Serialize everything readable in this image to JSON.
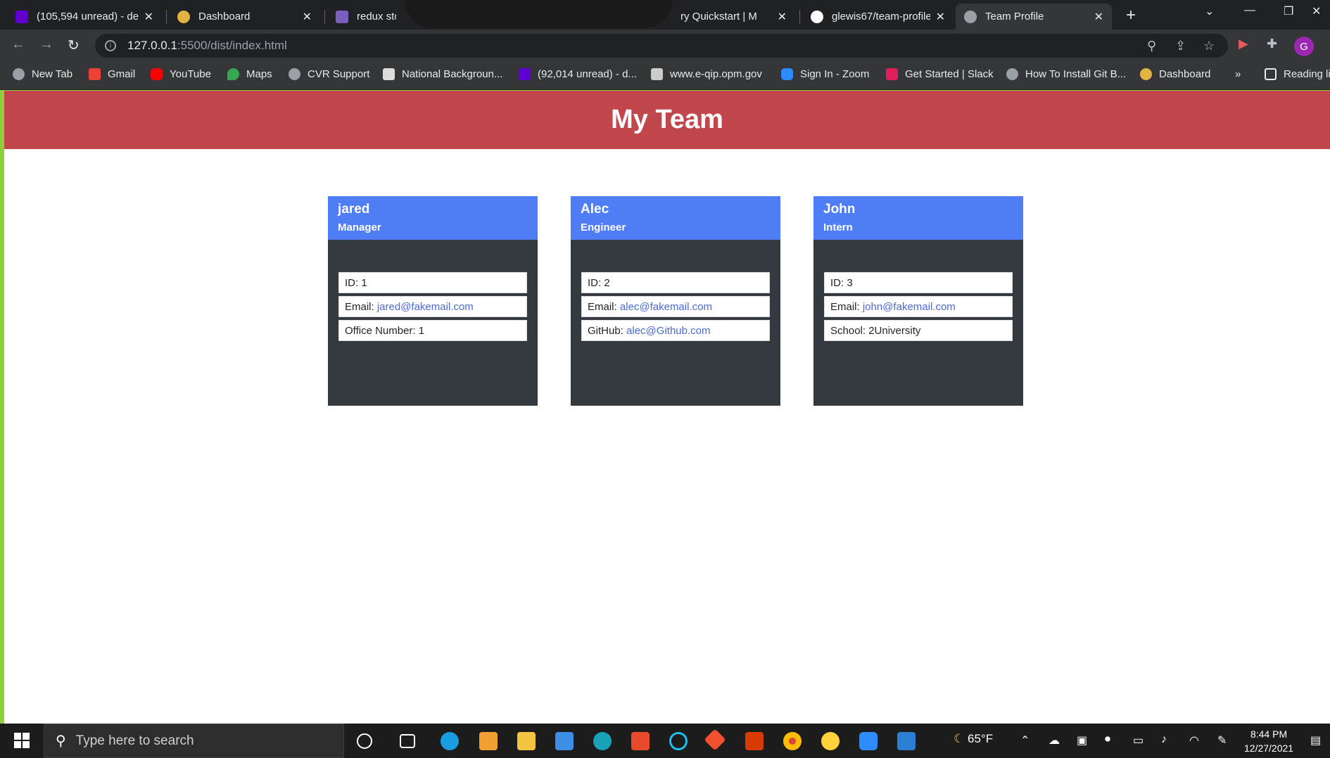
{
  "browser": {
    "tabs": [
      {
        "title": "(105,594 unread) - de",
        "icon": "yahoo-mail-icon",
        "color": "#6001d2"
      },
      {
        "title": "Dashboard",
        "icon": "coin-icon",
        "color": "#e3b341"
      },
      {
        "title": "redux store",
        "icon": "h-icon",
        "color": "#7a5fbf"
      },
      {
        "title": "ry Quickstart | M",
        "icon": "",
        "color": ""
      },
      {
        "title": "glewis67/team-profile",
        "icon": "github-icon",
        "color": "#ffffff"
      },
      {
        "title": "Team Profile",
        "icon": "globe-icon",
        "color": "#9aa0a6"
      }
    ],
    "url_host": "127.0.0.1",
    "url_path": ":5500/dist/index.html",
    "profile_initial": "G",
    "bookmarks": [
      {
        "label": "New Tab",
        "icon": "globe-icon",
        "color": "#9aa0a6"
      },
      {
        "label": "Gmail",
        "icon": "gmail-icon",
        "color": "#ea4335"
      },
      {
        "label": "YouTube",
        "icon": "youtube-icon",
        "color": "#ff0000"
      },
      {
        "label": "Maps",
        "icon": "maps-pin-icon",
        "color": "#34a853"
      },
      {
        "label": "CVR Support",
        "icon": "globe-icon",
        "color": "#9aa0a6"
      },
      {
        "label": "National Backgroun...",
        "icon": "doc-icon",
        "color": "#dddddd"
      },
      {
        "label": "(92,014 unread) - d...",
        "icon": "yahoo-mail-icon",
        "color": "#6001d2"
      },
      {
        "label": "www.e-qip.opm.gov",
        "icon": "eagle-icon",
        "color": "#cccccc"
      },
      {
        "label": "Sign In - Zoom",
        "icon": "zoom-icon",
        "color": "#2d8cff"
      },
      {
        "label": "Get Started | Slack",
        "icon": "slack-icon",
        "color": "#e01e5a"
      },
      {
        "label": "How To Install Git B...",
        "icon": "globe-icon",
        "color": "#9aa0a6"
      },
      {
        "label": "Dashboard",
        "icon": "coin-icon",
        "color": "#e3b341"
      }
    ],
    "bookmarks_overflow": "»",
    "reading_list": "Reading li"
  },
  "page": {
    "title": "My Team",
    "header_color": "#c2474d",
    "card_header_color": "#4f7df5",
    "cards": [
      {
        "name": "jared",
        "role": "Manager",
        "id_label": "ID: 1",
        "email_prefix": "Email: ",
        "email": "jared@fakemail.com",
        "extra_prefix": "Office Number: 1",
        "extra_link": ""
      },
      {
        "name": "Alec",
        "role": "Engineer",
        "id_label": "ID: 2",
        "email_prefix": "Email: ",
        "email": "alec@fakemail.com",
        "extra_prefix": "GitHub: ",
        "extra_link": "alec@Github.com"
      },
      {
        "name": "John",
        "role": "Intern",
        "id_label": "ID: 3",
        "email_prefix": "Email: ",
        "email": "john@fakemail.com",
        "extra_prefix": "School: 2University",
        "extra_link": ""
      }
    ]
  },
  "taskbar": {
    "search_placeholder": "Type here to search",
    "weather": "65°F",
    "time": "8:44 PM",
    "date": "12/27/2021",
    "apps": [
      "cortana-icon",
      "task-view-icon",
      "edge-icon",
      "store-icon",
      "file-explorer-icon",
      "mail-icon",
      "search-app-icon",
      "office-icon",
      "cortana-circle-icon",
      "git-icon",
      "office-red-icon",
      "chrome-icon",
      "emoji-icon",
      "zoom-icon",
      "vscode-icon"
    ]
  }
}
